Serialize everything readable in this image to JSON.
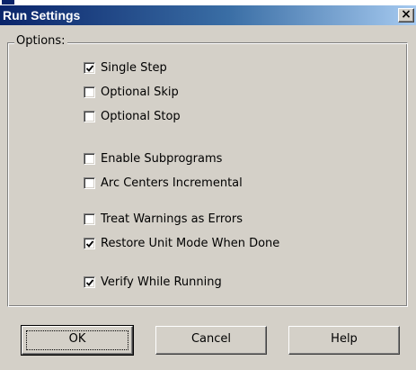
{
  "window": {
    "title": "Run Settings",
    "close_glyph": "×"
  },
  "options": {
    "legend": "Options:",
    "items": [
      {
        "label": "Single Step",
        "checked": true
      },
      {
        "label": "Optional Skip",
        "checked": false
      },
      {
        "label": "Optional Stop",
        "checked": false
      },
      {
        "label": "Enable Subprograms",
        "checked": false
      },
      {
        "label": "Arc Centers Incremental",
        "checked": false
      },
      {
        "label": "Treat Warnings as Errors",
        "checked": false
      },
      {
        "label": "Restore Unit Mode When Done",
        "checked": true
      },
      {
        "label": "Verify While Running",
        "checked": true
      }
    ]
  },
  "buttons": {
    "ok": "OK",
    "cancel": "Cancel",
    "help": "Help"
  },
  "colors": {
    "face": "#d4d0c8",
    "title_start": "#0a246a",
    "title_end": "#a6caf0"
  }
}
